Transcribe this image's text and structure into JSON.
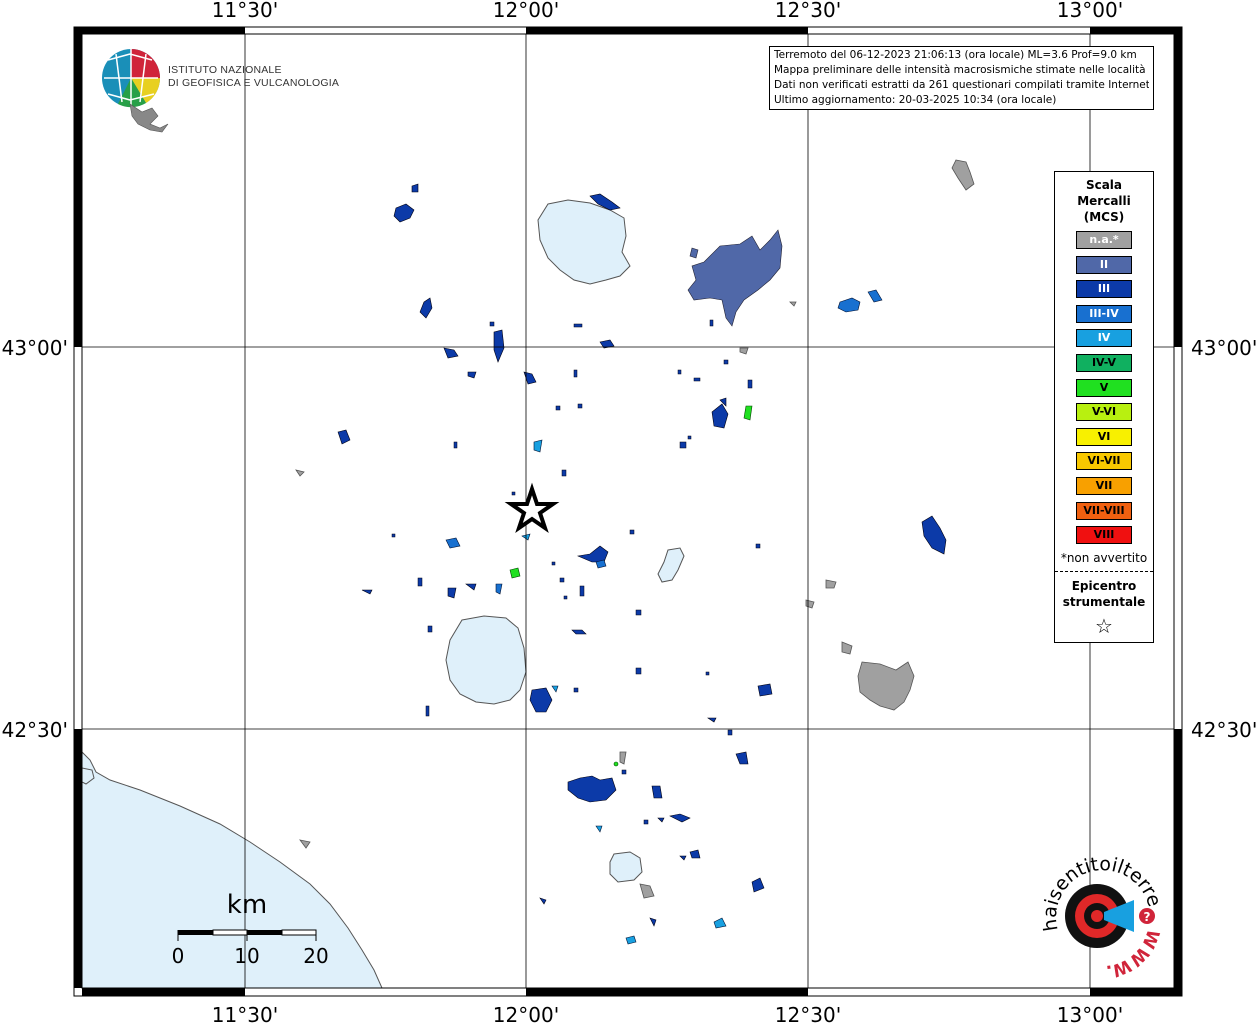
{
  "info": {
    "line1": "Terremoto del 06-12-2023 21:06:13 (ora locale) ML=3.6 Prof=9.0 km",
    "line2": "Mappa preliminare delle intensità macrosismiche stimate nelle località",
    "line3": "Dati non verificati estratti da 261 questionari compilati tramite Internet.",
    "line4": "Ultimo aggiornamento: 20-03-2025 10:34 (ora locale)"
  },
  "axes": {
    "top": [
      "11°30'",
      "12°00'",
      "12°30'",
      "13°00'"
    ],
    "bottom": [
      "11°30'",
      "12°00'",
      "12°30'",
      "13°00'"
    ],
    "left": [
      "43°00'",
      "42°30'"
    ],
    "right": [
      "43°00'",
      "42°30'"
    ]
  },
  "logo": {
    "line1": "ISTITUTO NAZIONALE",
    "line2": "DI GEOFISICA E VULCANOLOGIA"
  },
  "legend": {
    "title_line1": "Scala",
    "title_line2": "Mercalli",
    "title_line3": "(MCS)",
    "items": [
      {
        "label": "n.a.*",
        "color": "#a0a0a0"
      },
      {
        "label": "II",
        "color": "#5068a8"
      },
      {
        "label": "III",
        "color": "#0c3aa8"
      },
      {
        "label": "III-IV",
        "color": "#1870d0"
      },
      {
        "label": "IV",
        "color": "#18a0e0"
      },
      {
        "label": "IV-V",
        "color": "#10b060"
      },
      {
        "label": "V",
        "color": "#20e020"
      },
      {
        "label": "V-VI",
        "color": "#b8f010"
      },
      {
        "label": "VI",
        "color": "#f8f000"
      },
      {
        "label": "VI-VII",
        "color": "#f8c800"
      },
      {
        "label": "VII",
        "color": "#f8a000"
      },
      {
        "label": "VII-VIII",
        "color": "#f06010"
      },
      {
        "label": "VIII",
        "color": "#f01010"
      }
    ],
    "note": "*non avvertito",
    "epicenter_line1": "Epicentro",
    "epicenter_line2": "strumentale",
    "star": "☆"
  },
  "scalebar": {
    "unit": "km",
    "ticks": [
      "0",
      "10",
      "20"
    ]
  },
  "badge": {
    "text": "haisentitoilterremoto.it",
    "url": "WWW.",
    "question": "?"
  },
  "colors": {
    "water": "#dff0fa",
    "grid": "#000000"
  }
}
